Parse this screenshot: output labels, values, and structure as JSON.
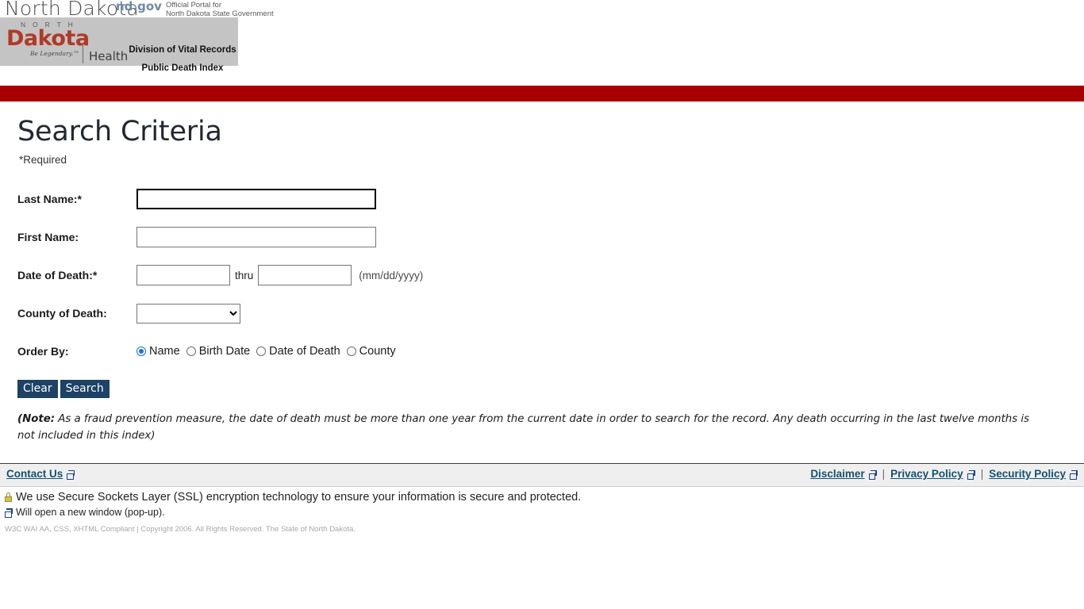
{
  "header": {
    "state_wordmark": "North Dakota",
    "portal_logo": "nd.gov",
    "portal_tagline_line1": "Official Portal for",
    "portal_tagline_line2": "North Dakota State Government",
    "logo_north": "N O R T H",
    "logo_dakota": "Dakota",
    "logo_tagline": "Be Legendary.™",
    "logo_department": "Health",
    "banner_line1": "Division of Vital Records",
    "banner_line2": "Public Death Index",
    "accent_red": "#a80000"
  },
  "main": {
    "page_title": "Search Criteria",
    "required_note": "*Required",
    "fields": {
      "last_name_label": "Last Name:*",
      "last_name_value": "",
      "first_name_label": "First Name:",
      "first_name_value": "",
      "date_of_death_label": "Date of Death:*",
      "date_from_value": "",
      "date_thru_label": "thru",
      "date_to_value": "",
      "date_format_hint": "(mm/dd/yyyy)",
      "county_label": "County of Death:",
      "county_value": "",
      "county_options": [
        ""
      ],
      "order_by_label": "Order By:"
    },
    "order_by_options": [
      {
        "label": "Name",
        "checked": true
      },
      {
        "label": "Birth Date",
        "checked": false
      },
      {
        "label": "Date of Death",
        "checked": false
      },
      {
        "label": "County",
        "checked": false
      }
    ],
    "buttons": {
      "clear": "Clear",
      "search": "Search",
      "color": "#1c4266"
    },
    "note_prefix": "(Note:",
    "note_text": " As a fraud prevention measure, the date of death must be more than one year from the current date in order to search for the record. Any death occurring in the last twelve months is not included in this index)"
  },
  "footer": {
    "contact_us": "Contact Us",
    "disclaimer": "Disclaimer",
    "privacy_policy": "Privacy Policy",
    "security_policy": "Security Policy",
    "separator": "|",
    "ssl_text": "We use Secure Sockets Layer (SSL) encryption technology to ensure your information is secure and protected.",
    "popup_note": "Will open a new window (pop-up).",
    "compliance": "W3C WAI AA, CSS, XHTML Compliant | Copyright 2006. All Rights Reserved. The State of North Dakota."
  }
}
